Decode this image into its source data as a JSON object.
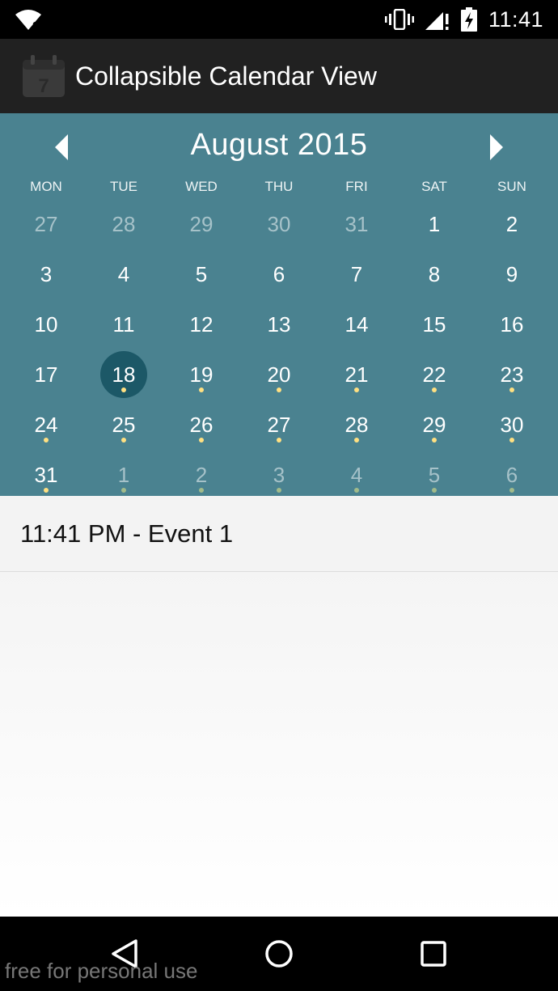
{
  "status_bar": {
    "time": "11:41"
  },
  "app": {
    "title": "Collapsible Calendar View",
    "icon_number": "7"
  },
  "calendar": {
    "month_title": "August 2015",
    "weekdays": [
      "MON",
      "TUE",
      "WED",
      "THU",
      "FRI",
      "SAT",
      "SUN"
    ],
    "weeks": [
      [
        {
          "d": "27",
          "other": true,
          "dot": false
        },
        {
          "d": "28",
          "other": true,
          "dot": false
        },
        {
          "d": "29",
          "other": true,
          "dot": false
        },
        {
          "d": "30",
          "other": true,
          "dot": false
        },
        {
          "d": "31",
          "other": true,
          "dot": false
        },
        {
          "d": "1",
          "other": false,
          "dot": false
        },
        {
          "d": "2",
          "other": false,
          "dot": false
        }
      ],
      [
        {
          "d": "3",
          "other": false,
          "dot": false
        },
        {
          "d": "4",
          "other": false,
          "dot": false
        },
        {
          "d": "5",
          "other": false,
          "dot": false
        },
        {
          "d": "6",
          "other": false,
          "dot": false
        },
        {
          "d": "7",
          "other": false,
          "dot": false
        },
        {
          "d": "8",
          "other": false,
          "dot": false
        },
        {
          "d": "9",
          "other": false,
          "dot": false
        }
      ],
      [
        {
          "d": "10",
          "other": false,
          "dot": false
        },
        {
          "d": "11",
          "other": false,
          "dot": false
        },
        {
          "d": "12",
          "other": false,
          "dot": false
        },
        {
          "d": "13",
          "other": false,
          "dot": false
        },
        {
          "d": "14",
          "other": false,
          "dot": false
        },
        {
          "d": "15",
          "other": false,
          "dot": false
        },
        {
          "d": "16",
          "other": false,
          "dot": false
        }
      ],
      [
        {
          "d": "17",
          "other": false,
          "dot": false
        },
        {
          "d": "18",
          "other": false,
          "dot": true,
          "selected": true
        },
        {
          "d": "19",
          "other": false,
          "dot": true
        },
        {
          "d": "20",
          "other": false,
          "dot": true
        },
        {
          "d": "21",
          "other": false,
          "dot": true
        },
        {
          "d": "22",
          "other": false,
          "dot": true
        },
        {
          "d": "23",
          "other": false,
          "dot": true
        }
      ],
      [
        {
          "d": "24",
          "other": false,
          "dot": true
        },
        {
          "d": "25",
          "other": false,
          "dot": true
        },
        {
          "d": "26",
          "other": false,
          "dot": true
        },
        {
          "d": "27",
          "other": false,
          "dot": true
        },
        {
          "d": "28",
          "other": false,
          "dot": true
        },
        {
          "d": "29",
          "other": false,
          "dot": true
        },
        {
          "d": "30",
          "other": false,
          "dot": true
        }
      ],
      [
        {
          "d": "31",
          "other": false,
          "dot": true
        },
        {
          "d": "1",
          "other": true,
          "dot": true
        },
        {
          "d": "2",
          "other": true,
          "dot": true
        },
        {
          "d": "3",
          "other": true,
          "dot": true
        },
        {
          "d": "4",
          "other": true,
          "dot": true
        },
        {
          "d": "5",
          "other": true,
          "dot": true
        },
        {
          "d": "6",
          "other": true,
          "dot": true
        }
      ]
    ],
    "colors": {
      "background": "#4a8290",
      "selected": "#1c5867",
      "event_dot": "#ffe082"
    }
  },
  "events": [
    {
      "label": "11:41 PM - Event 1"
    }
  ],
  "watermark": "free for personal use",
  "icons": {
    "wifi": "wifi-unknown-icon",
    "vibrate": "vibrate-icon",
    "signal": "signal-no-data-icon",
    "battery": "battery-charging-icon",
    "prev": "chevron-left-icon",
    "next": "chevron-right-icon",
    "back": "back-triangle-icon",
    "home": "home-circle-icon",
    "recent": "recent-apps-square-icon"
  }
}
